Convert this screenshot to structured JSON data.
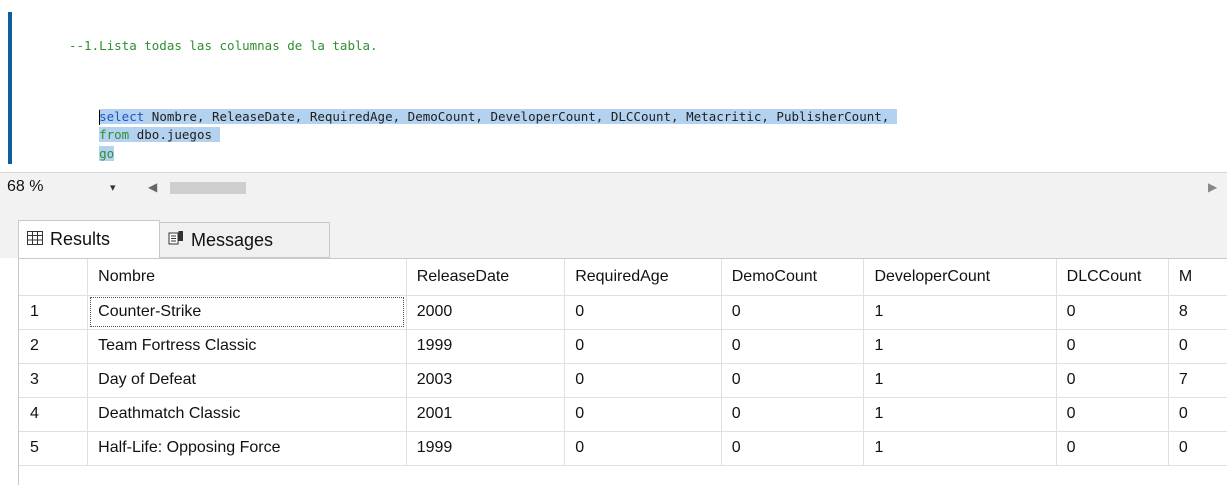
{
  "editor": {
    "comment_line": "--1.Lista todas las columnas de la tabla.",
    "select_keyword": "select",
    "select_rest": " Nombre, ReleaseDate, RequiredAge, DemoCount, DeveloperCount, DLCCount, Metacritic, PublisherCount, ",
    "from_keyword": "from",
    "from_rest": " dbo.juegos ",
    "go_keyword": "go"
  },
  "statusbar": {
    "zoom": "68 %",
    "dropdown_icon": "▾",
    "scroll_left_icon": "◀",
    "scroll_right_icon": "▶"
  },
  "tabs": {
    "results_label": "Results",
    "messages_label": "Messages",
    "results_icon": "grid-icon",
    "messages_icon": "messages-icon"
  },
  "grid": {
    "columns": [
      "Nombre",
      "ReleaseDate",
      "RequiredAge",
      "DemoCount",
      "DeveloperCount",
      "DLCCount",
      "M"
    ],
    "rows": [
      {
        "n": "1",
        "cells": [
          "Counter-Strike",
          "2000",
          "0",
          "0",
          "1",
          "0",
          "8"
        ]
      },
      {
        "n": "2",
        "cells": [
          "Team Fortress Classic",
          "1999",
          "0",
          "0",
          "1",
          "0",
          "0"
        ]
      },
      {
        "n": "3",
        "cells": [
          "Day of Defeat",
          "2003",
          "0",
          "0",
          "1",
          "0",
          "7"
        ]
      },
      {
        "n": "4",
        "cells": [
          "Deathmatch Classic",
          "2001",
          "0",
          "0",
          "1",
          "0",
          "0"
        ]
      },
      {
        "n": "5",
        "cells": [
          "Half-Life: Opposing Force",
          "1999",
          "0",
          "0",
          "1",
          "0",
          "0"
        ]
      }
    ]
  },
  "colors": {
    "comment": "#2f8f2f",
    "keyword": "#1c55c9",
    "selection": "#b3d2f0"
  }
}
